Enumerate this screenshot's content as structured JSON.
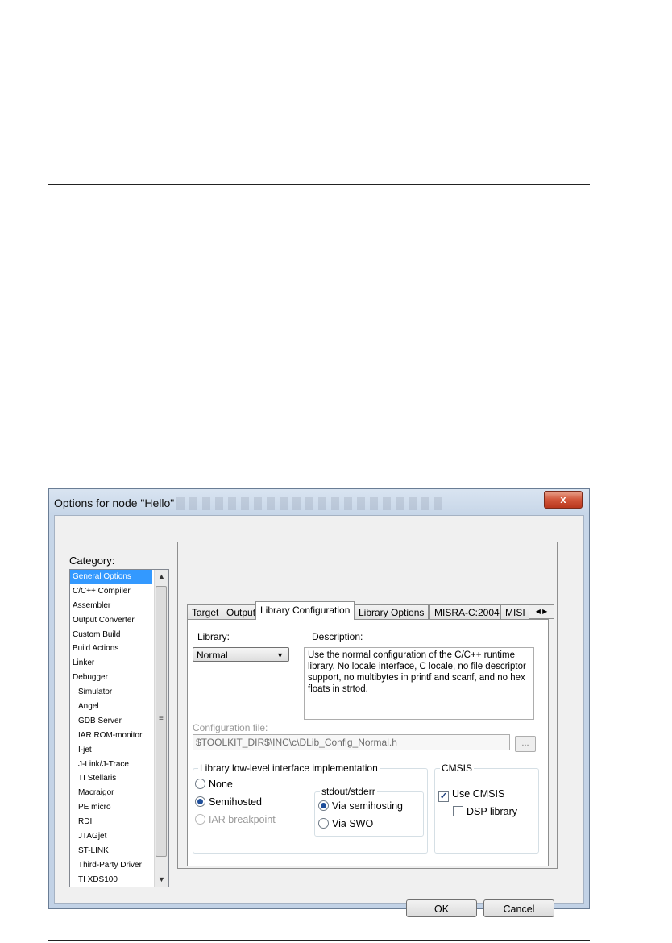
{
  "dialog": {
    "title": "Options for node \"Hello\"",
    "close_label": "x"
  },
  "category": {
    "label": "Category:",
    "items": [
      {
        "label": "General Options",
        "selected": true,
        "indent": false
      },
      {
        "label": "C/C++ Compiler",
        "selected": false,
        "indent": false
      },
      {
        "label": "Assembler",
        "selected": false,
        "indent": false
      },
      {
        "label": "Output Converter",
        "selected": false,
        "indent": false
      },
      {
        "label": "Custom Build",
        "selected": false,
        "indent": false
      },
      {
        "label": "Build Actions",
        "selected": false,
        "indent": false
      },
      {
        "label": "Linker",
        "selected": false,
        "indent": false
      },
      {
        "label": "Debugger",
        "selected": false,
        "indent": false
      },
      {
        "label": "Simulator",
        "selected": false,
        "indent": true
      },
      {
        "label": "Angel",
        "selected": false,
        "indent": true
      },
      {
        "label": "GDB Server",
        "selected": false,
        "indent": true
      },
      {
        "label": "IAR ROM-monitor",
        "selected": false,
        "indent": true
      },
      {
        "label": "I-jet",
        "selected": false,
        "indent": true
      },
      {
        "label": "J-Link/J-Trace",
        "selected": false,
        "indent": true
      },
      {
        "label": "TI Stellaris",
        "selected": false,
        "indent": true
      },
      {
        "label": "Macraigor",
        "selected": false,
        "indent": true
      },
      {
        "label": "PE micro",
        "selected": false,
        "indent": true
      },
      {
        "label": "RDI",
        "selected": false,
        "indent": true
      },
      {
        "label": "JTAGjet",
        "selected": false,
        "indent": true
      },
      {
        "label": "ST-LINK",
        "selected": false,
        "indent": true
      },
      {
        "label": "Third-Party Driver",
        "selected": false,
        "indent": true
      },
      {
        "label": "TI XDS100",
        "selected": false,
        "indent": true
      }
    ]
  },
  "tabs": [
    {
      "label": "Target",
      "active": false
    },
    {
      "label": "Output",
      "active": false
    },
    {
      "label": "Library Configuration",
      "active": true
    },
    {
      "label": "Library Options",
      "active": false
    },
    {
      "label": "MISRA-C:2004",
      "active": false
    },
    {
      "label": "MISI",
      "active": false
    }
  ],
  "library": {
    "label": "Library:",
    "value": "Normal",
    "description_label": "Description:",
    "description": "Use the normal configuration of the C/C++ runtime library. No locale interface, C locale, no file descriptor support, no multibytes in printf and scanf, and no hex floats in strtod."
  },
  "config_file": {
    "label": "Configuration file:",
    "value": "$TOOLKIT_DIR$\\INC\\c\\DLib_Config_Normal.h",
    "browse_label": "..."
  },
  "low_level": {
    "title": "Library low-level interface implementation",
    "options": [
      {
        "label": "None",
        "checked": false,
        "disabled": false
      },
      {
        "label": "Semihosted",
        "checked": true,
        "disabled": false
      },
      {
        "label": "IAR breakpoint",
        "checked": false,
        "disabled": true
      }
    ],
    "stdout_title": "stdout/stderr",
    "stdout_options": [
      {
        "label": "Via semihosting",
        "checked": true
      },
      {
        "label": "Via SWO",
        "checked": false
      }
    ]
  },
  "cmsis": {
    "title": "CMSIS",
    "use_cmsis_label": "Use CMSIS",
    "use_cmsis_checked": true,
    "dsp_label": "DSP library",
    "dsp_checked": false
  },
  "buttons": {
    "ok": "OK",
    "cancel": "Cancel"
  }
}
